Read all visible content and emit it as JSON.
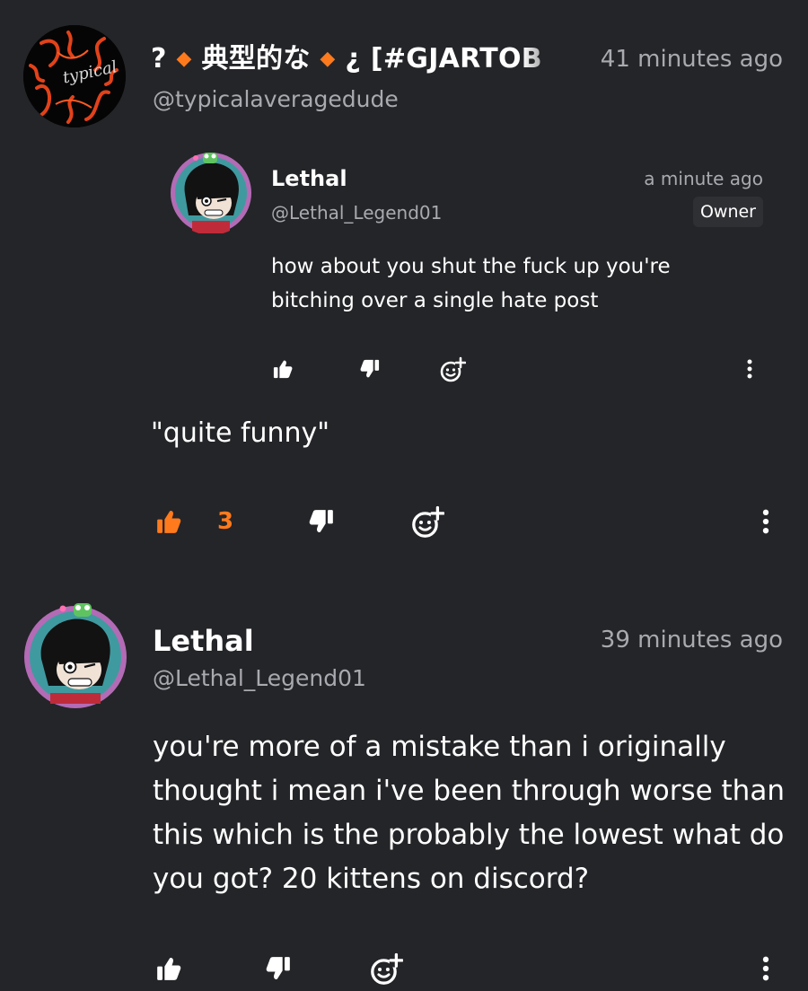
{
  "colors": {
    "background": "#242528",
    "text_primary": "#ffffff",
    "text_muted": "#a9aab0",
    "accent_liked": "#ff7a1c",
    "badge_bg": "#2f3034"
  },
  "comments": [
    {
      "author": {
        "name_prefix": "?",
        "name_middle": "典型的な",
        "name_suffix": "¿ [#GJARTOB",
        "handle": "@typicalaveragedude",
        "avatar_logo_text": "typical",
        "avatar_icon": "orange-swirl-avatar-icon"
      },
      "timestamp": "41 minutes ago",
      "text": "\"quite funny\"",
      "like_count": "3",
      "liked": true,
      "replies": [
        {
          "author": {
            "name": "Lethal",
            "handle": "@Lethal_Legend01",
            "badge": "Owner",
            "avatar_icon": "cartoon-character-avatar-icon"
          },
          "timestamp": "a minute ago",
          "text": "how about you shut the fuck up you're bitching over a single hate post"
        }
      ]
    },
    {
      "author": {
        "name": "Lethal",
        "handle": "@Lethal_Legend01",
        "avatar_icon": "cartoon-character-avatar-icon"
      },
      "timestamp": "39 minutes ago",
      "text": "you're more of a mistake than i originally thought i mean i've been through worse than this which is the probably the lowest what do you got? 20 kittens on discord?"
    }
  ],
  "icons": {
    "like": "thumbs-up-icon",
    "dislike": "thumbs-down-icon",
    "react": "add-reaction-icon",
    "more": "more-vertical-icon"
  }
}
